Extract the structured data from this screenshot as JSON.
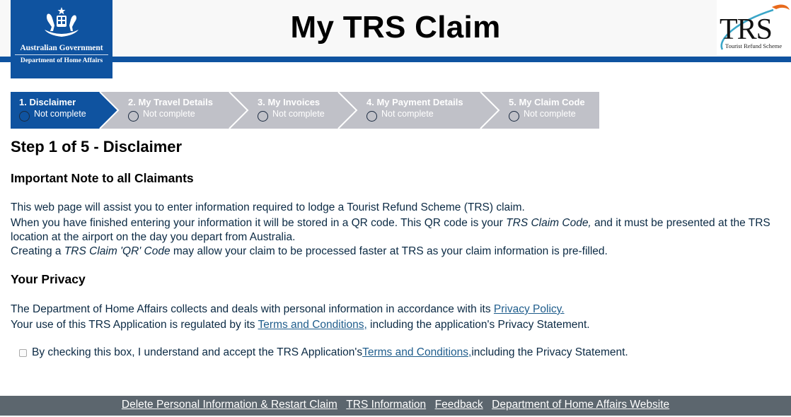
{
  "header": {
    "title": "My TRS Claim",
    "gov_logo": {
      "icon": "coat-of-arms-icon",
      "line1": "Australian Government",
      "line2": "Department of Home Affairs"
    },
    "trs_logo": {
      "letters": "TRS",
      "subtitle": "Tourist Refund Scheme"
    }
  },
  "colors": {
    "brand_blue": "#0f53a0",
    "step_inactive": "#c0c1c8",
    "footer_bg": "#5c666e",
    "link": "#1f5d8c",
    "text": "#0b2a44"
  },
  "steps": [
    {
      "title": "1. Disclaimer",
      "status": "Not complete",
      "active": true
    },
    {
      "title": "2. My Travel Details",
      "status": "Not complete",
      "active": false
    },
    {
      "title": "3. My Invoices",
      "status": "Not complete",
      "active": false
    },
    {
      "title": "4. My Payment Details",
      "status": "Not complete",
      "active": false
    },
    {
      "title": "5. My Claim Code",
      "status": "Not complete",
      "active": false
    }
  ],
  "main": {
    "step_heading": "Step 1 of 5 - Disclaimer",
    "important_note": {
      "heading": "Important Note to all Claimants",
      "line1": "This web page will assist you to enter information required to lodge a Tourist Refund Scheme (TRS) claim.",
      "line2_pre": "When you have finished entering your information it will be stored in a QR code. This QR code is your ",
      "line2_em": "TRS Claim Code,",
      "line2_post": " and it must be presented at the TRS location at the airport on the day you depart from Australia.",
      "line3_pre": "Creating a ",
      "line3_em": "TRS Claim 'QR' Code",
      "line3_post": " may allow your claim to be processed faster at TRS as your claim information is pre-filled."
    },
    "privacy": {
      "heading": "Your Privacy",
      "line1_pre": "The Department of Home Affairs collects and deals with personal information in accordance with its ",
      "line1_link": "Privacy Policy.",
      "line2_pre": "Your use of this TRS Application is regulated by its ",
      "line2_link": "Terms and Conditions,",
      "line2_post": " including the application's Privacy Statement."
    },
    "consent": {
      "checked": false,
      "pre": "By checking this box, I understand and accept the TRS Application's ",
      "link": "Terms and Conditions,",
      "post": " including the Privacy Statement."
    }
  },
  "footer": {
    "links": [
      "Delete Personal Information & Restart Claim",
      "TRS Information",
      "Feedback",
      "Department of Home Affairs Website"
    ]
  }
}
